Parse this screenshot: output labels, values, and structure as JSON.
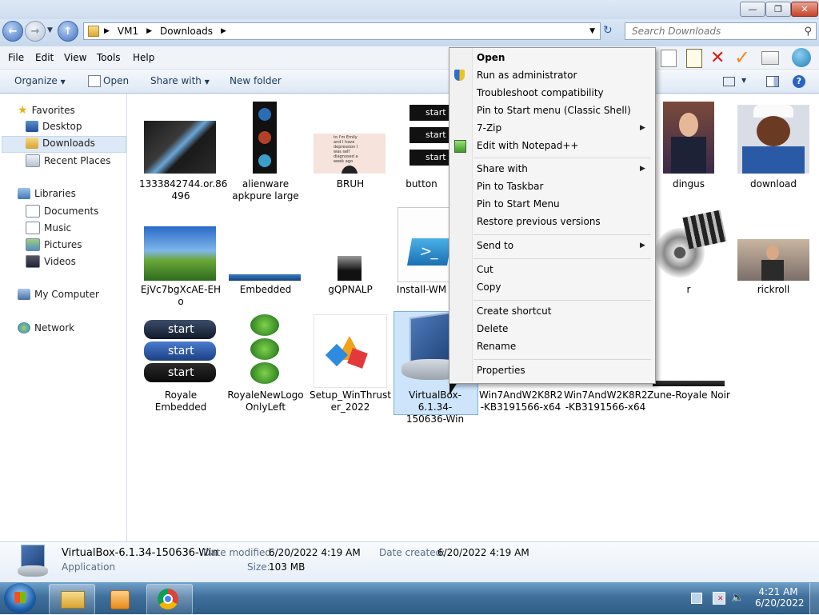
{
  "window": {
    "caption_buttons": {
      "minimize": "—",
      "maximize": "❐",
      "close": "✕"
    }
  },
  "address": {
    "crumbs": [
      "VM1",
      "Downloads"
    ],
    "search_placeholder": "Search Downloads"
  },
  "menubar": [
    "File",
    "Edit",
    "View",
    "Tools",
    "Help"
  ],
  "commandbar": {
    "organize": "Organize",
    "open": "Open",
    "share_with": "Share with",
    "new_folder": "New folder"
  },
  "navpane": {
    "favorites": "Favorites",
    "desktop": "Desktop",
    "downloads": "Downloads",
    "recent_places": "Recent Places",
    "libraries": "Libraries",
    "documents": "Documents",
    "music": "Music",
    "pictures": "Pictures",
    "videos": "Videos",
    "my_computer": "My Computer",
    "network": "Network"
  },
  "files": [
    {
      "line1": "1333842744.or.86",
      "line2": "496"
    },
    {
      "line1": "alienware",
      "line2": "apkpure large"
    },
    {
      "line1": "BRUH",
      "line2": ""
    },
    {
      "line1": "button",
      "line2": ""
    },
    {
      "line1": "dingus",
      "line2": ""
    },
    {
      "line1": "download",
      "line2": ""
    },
    {
      "line1": "EjVc7bgXcAE-EH",
      "line2": "o"
    },
    {
      "line1": "Embedded",
      "line2": ""
    },
    {
      "line1": "gQPNALP",
      "line2": ""
    },
    {
      "line1": "Install-WM",
      "line2": ""
    },
    {
      "line1": "r",
      "line2": ""
    },
    {
      "line1": "rickroll",
      "line2": ""
    },
    {
      "line1": "Royale",
      "line2": "Embedded"
    },
    {
      "line1": "RoyaleNewLogo",
      "line2": "OnlyLeft"
    },
    {
      "line1": "Setup_WinThrust",
      "line2": "er_2022"
    },
    {
      "line1": "VirtualBox-6.1.34-",
      "line2": "150636-Win"
    },
    {
      "line1": "Win7AndW2K8R2",
      "line2": "-KB3191566-x64"
    },
    {
      "line1": "Win7AndW2K8R2",
      "line2": "-KB3191566-x64"
    },
    {
      "line1": "Zune-Royale Noir",
      "line2": ""
    }
  ],
  "thumb_text": {
    "start": "start",
    "bruh_caption": "to I'm Emily and I have depression I was self diagnosed a week ago"
  },
  "context_menu": {
    "open": "Open",
    "run_as_admin": "Run as administrator",
    "troubleshoot": "Troubleshoot compatibility",
    "pin_start_classic": "Pin to Start menu (Classic Shell)",
    "seven_zip": "7-Zip",
    "edit_notepad": "Edit with Notepad++",
    "share_with": "Share with",
    "pin_taskbar": "Pin to Taskbar",
    "pin_start": "Pin to Start Menu",
    "restore_versions": "Restore previous versions",
    "send_to": "Send to",
    "cut": "Cut",
    "copy": "Copy",
    "create_shortcut": "Create shortcut",
    "delete": "Delete",
    "rename": "Rename",
    "properties": "Properties"
  },
  "details": {
    "filename": "VirtualBox-6.1.34-150636-Win",
    "type": "Application",
    "date_modified_label": "Date modified:",
    "date_modified": "6/20/2022 4:19 AM",
    "date_created_label": "Date created:",
    "date_created": "6/20/2022 4:19 AM",
    "size_label": "Size:",
    "size": "103 MB"
  },
  "taskbar": {
    "time": "4:21 AM",
    "date": "6/20/2022"
  }
}
